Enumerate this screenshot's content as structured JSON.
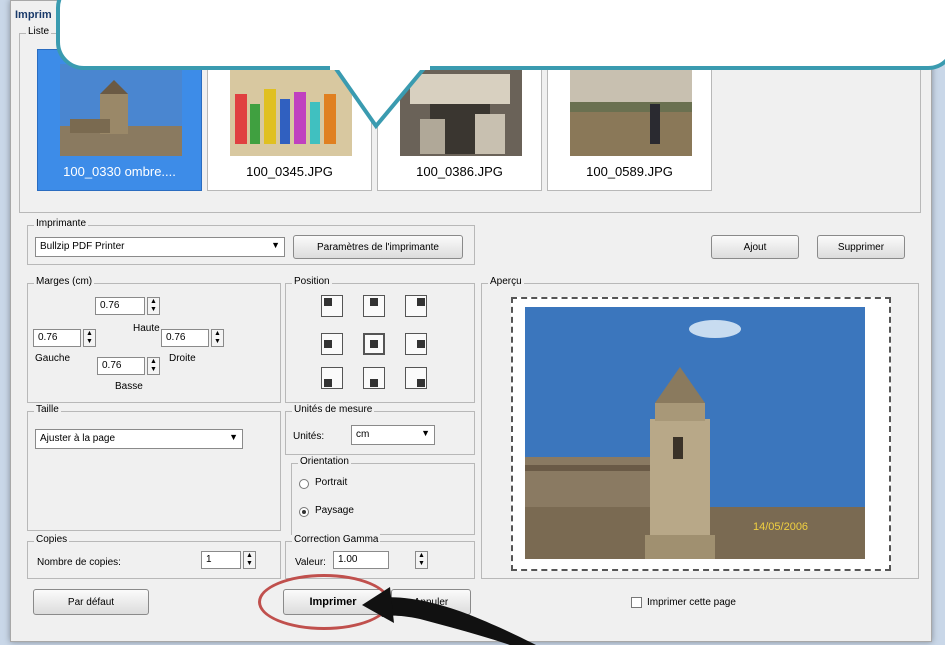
{
  "window": {
    "title": "Imprim"
  },
  "thumbnails": {
    "group_label": "Liste",
    "items": [
      {
        "caption": "100_0330 ombre....",
        "selected": true
      },
      {
        "caption": "100_0345.JPG",
        "selected": false
      },
      {
        "caption": "100_0386.JPG",
        "selected": false
      },
      {
        "caption": "100_0589.JPG",
        "selected": false
      }
    ]
  },
  "printer": {
    "group_label": "Imprimante",
    "selected": "Bullzip PDF Printer",
    "settings_button": "Paramètres de l'imprimante"
  },
  "list_buttons": {
    "add": "Ajout",
    "remove": "Supprimer"
  },
  "margins": {
    "group_label": "Marges (cm)",
    "top_value": "0.76",
    "left_value": "0.76",
    "right_value": "0.76",
    "bottom_value": "0.76",
    "top_label": "Haute",
    "left_label": "Gauche",
    "right_label": "Droite",
    "bottom_label": "Basse"
  },
  "position": {
    "group_label": "Position"
  },
  "size": {
    "group_label": "Taille",
    "selected": "Ajuster à la page"
  },
  "units": {
    "group_label": "Unités de mesure",
    "label": "Unités:",
    "selected": "cm"
  },
  "orientation": {
    "group_label": "Orientation",
    "portrait": "Portrait",
    "landscape": "Paysage",
    "selected": "Paysage"
  },
  "copies": {
    "group_label": "Copies",
    "label": "Nombre de copies:",
    "value": "1"
  },
  "gamma": {
    "group_label": "Correction Gamma",
    "label": "Valeur:",
    "value": "1.00"
  },
  "preview": {
    "group_label": "Aperçu",
    "date_stamp": "14/05/2006",
    "print_page_label": "Imprimer cette page"
  },
  "buttons": {
    "default": "Par défaut",
    "print": "Imprimer",
    "cancel": "Annuler"
  },
  "colors": {
    "selection": "#3d8ce8",
    "callout_border": "#3a9bb0",
    "highlight_circle": "#c0504d"
  }
}
